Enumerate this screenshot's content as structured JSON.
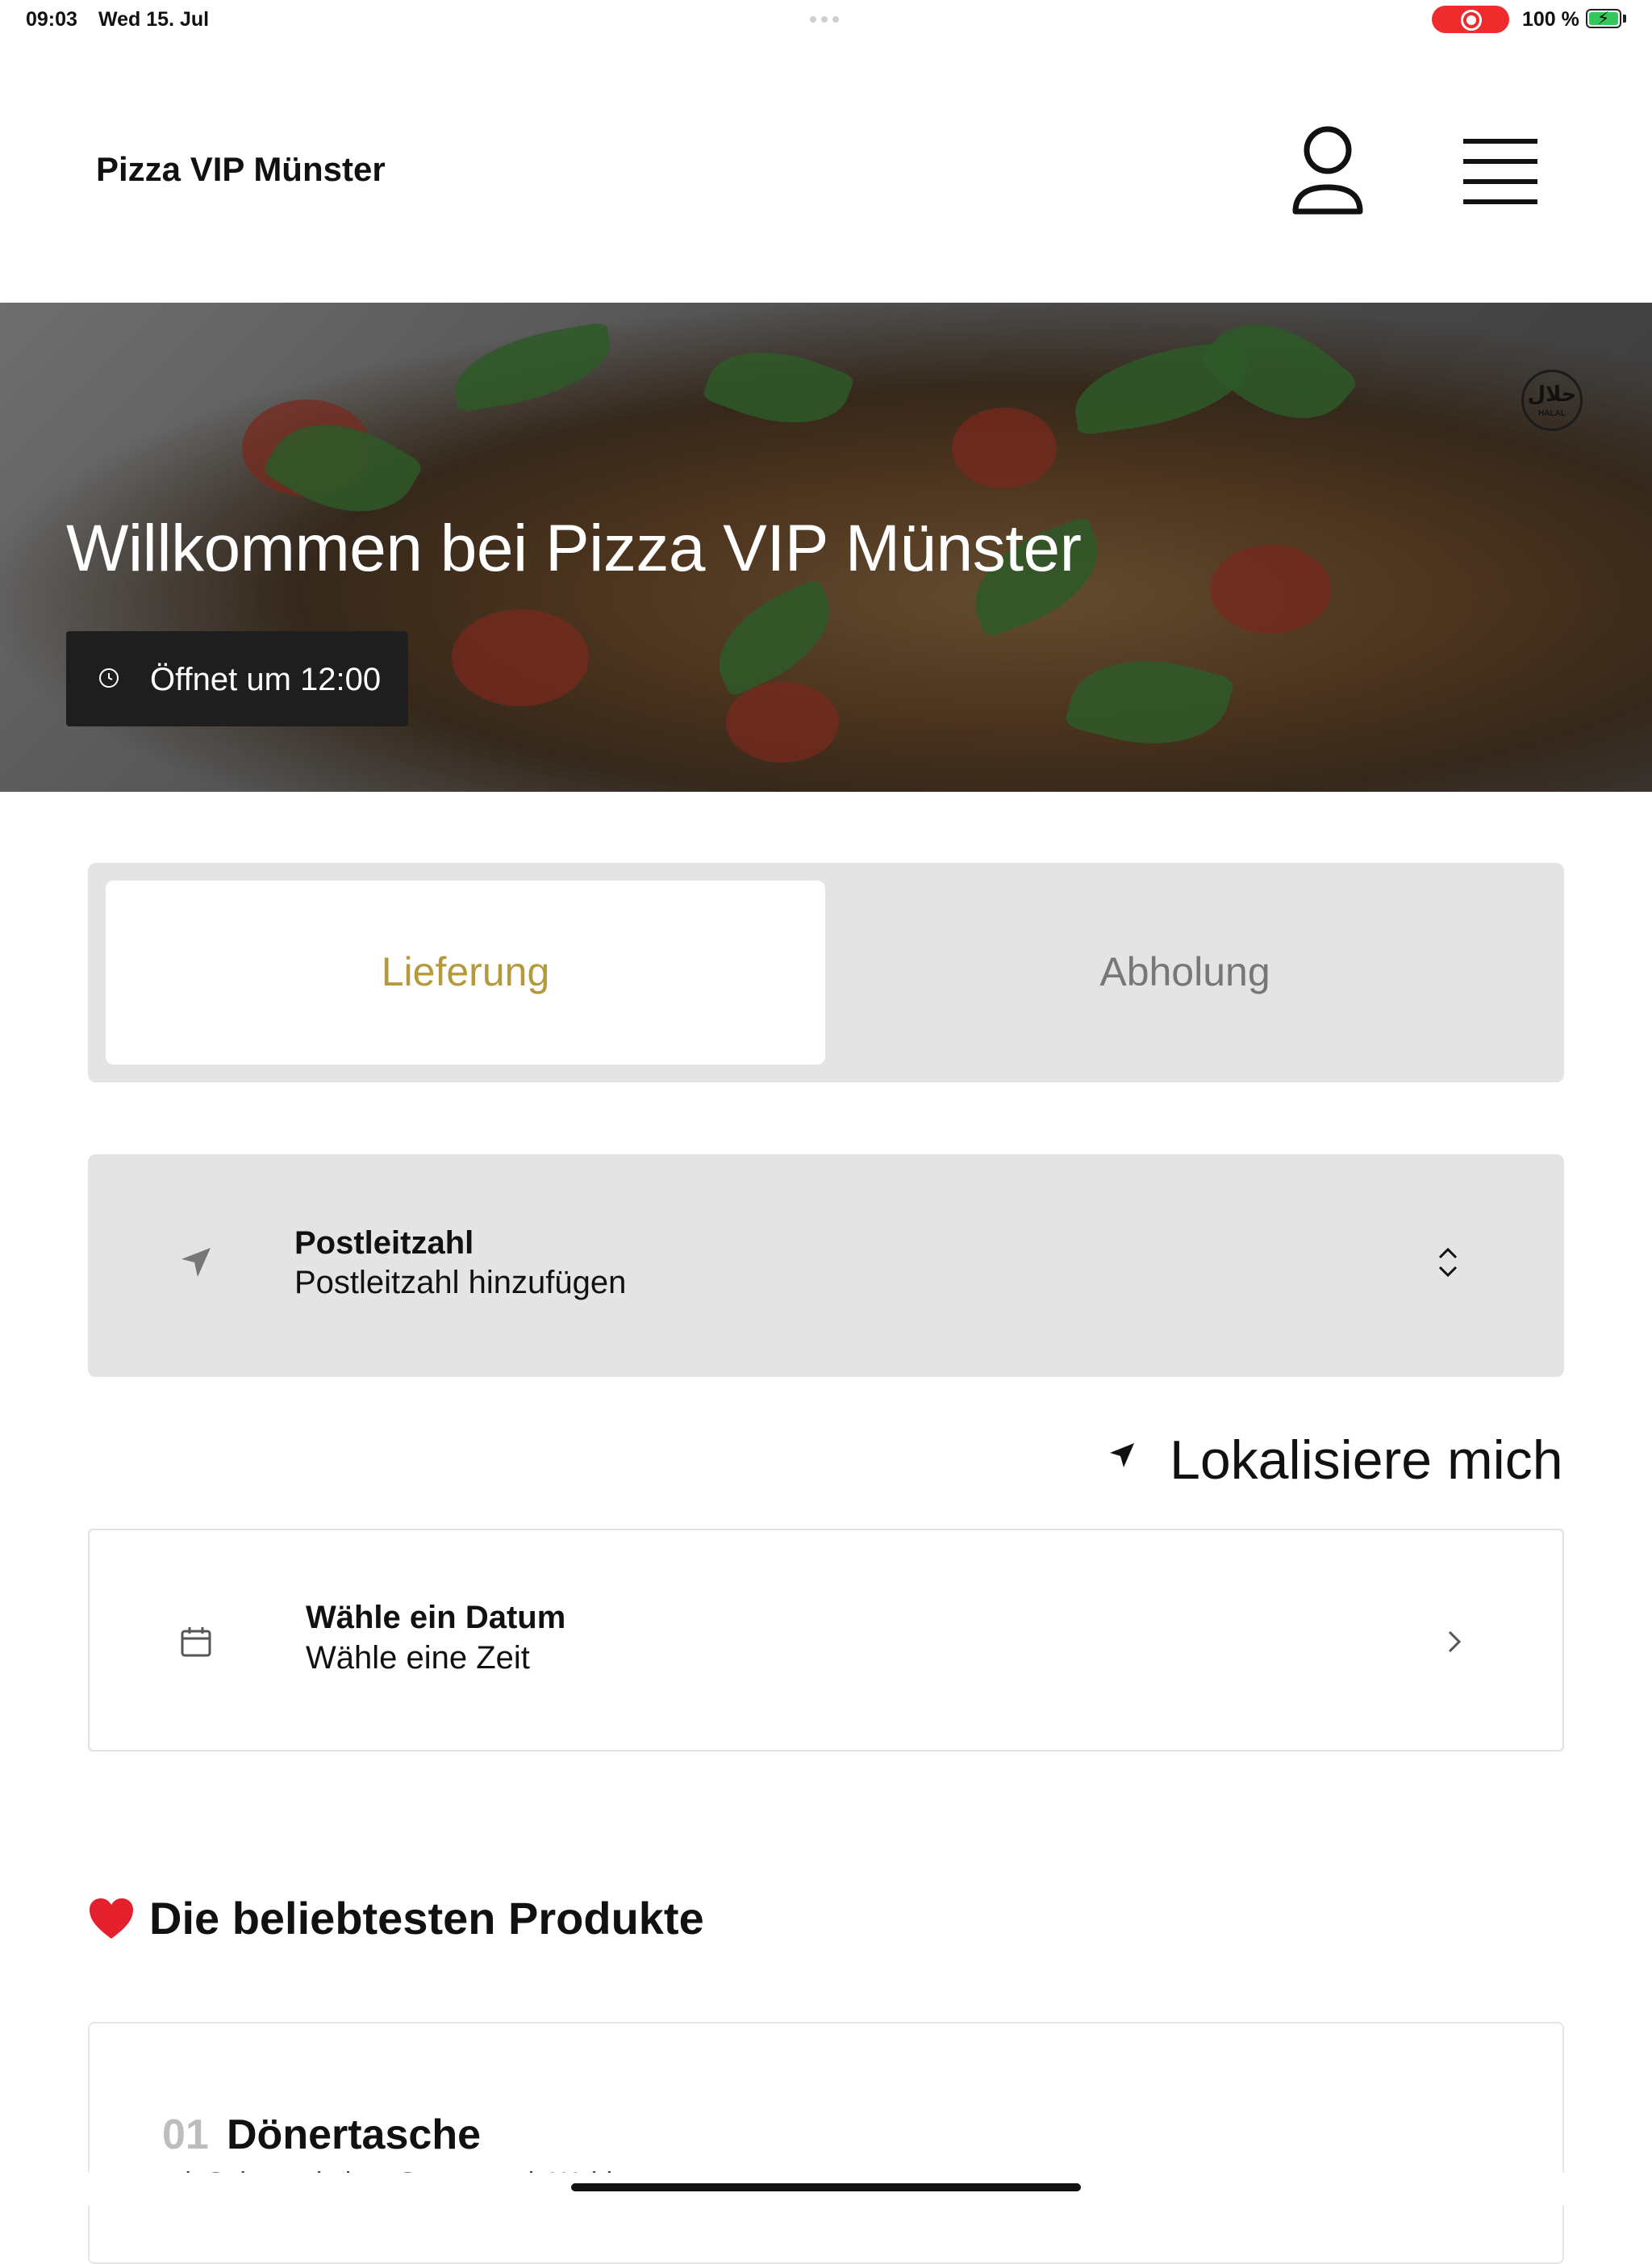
{
  "status_bar": {
    "time": "09:03",
    "date": "Wed 15. Jul",
    "battery_percent": "100 %",
    "recording_color": "#ef2b2b"
  },
  "header": {
    "brand": "Pizza VIP Münster",
    "user_icon": "user-icon",
    "menu_icon": "hamburger-menu-icon"
  },
  "hero": {
    "title": "Willkommen bei Pizza VIP Münster",
    "hours_text": "Öffnet um 12:00",
    "halal_script": "حلال",
    "halal_label": "HALAL"
  },
  "order_mode": {
    "options": [
      {
        "label": "Lieferung",
        "active": true
      },
      {
        "label": "Abholung",
        "active": false
      }
    ],
    "active_color": "#b49a3d"
  },
  "postal": {
    "label": "Postleitzahl",
    "value": "Postleitzahl hinzufügen"
  },
  "locate": {
    "label": "Lokalisiere mich"
  },
  "schedule": {
    "label": "Wähle ein Datum",
    "value": "Wähle eine Zeit"
  },
  "popular": {
    "title": "Die beliebtesten Produkte",
    "products": [
      {
        "number": "01",
        "name": "Dönertasche",
        "description": "mit Salat und einer Sauce nach Wahl"
      }
    ]
  }
}
